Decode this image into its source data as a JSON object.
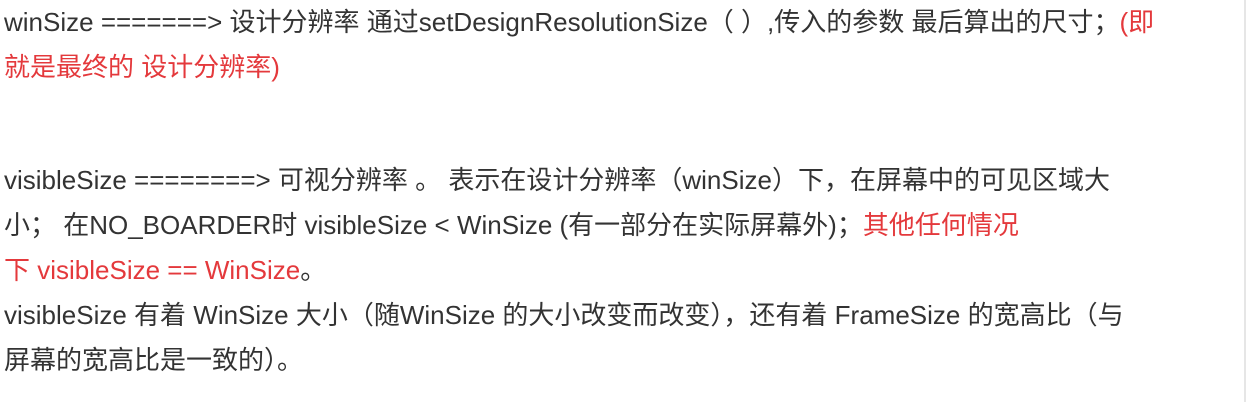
{
  "p1": {
    "line1_text": "winSize =======>  设计分辨率 通过setDesignResolutionSize（ ）,传入的参数 最后算出的尺寸；",
    "line1_red": "(即",
    "line2_red": "就是最终的 设计分辨率)"
  },
  "p2": {
    "line1": "visibleSize ========> 可视分辨率 。 表示在设计分辨率（winSize）下，在屏幕中的可见区域大",
    "line2_text": "小； 在NO_BOARDER时  visibleSize < WinSize (有一部分在实际屏幕外)；",
    "line2_red": "其他任何情况",
    "line3_red": "下 visibleSize == WinSize",
    "line3_end": "。"
  },
  "p3": {
    "line1": "visibleSize 有着 WinSize 大小（随WinSize 的大小改变而改变），还有着 FrameSize 的宽高比（与",
    "line2": "屏幕的宽高比是一致的）。"
  },
  "colors": {
    "text": "#333333",
    "highlight": "#e4393c"
  }
}
